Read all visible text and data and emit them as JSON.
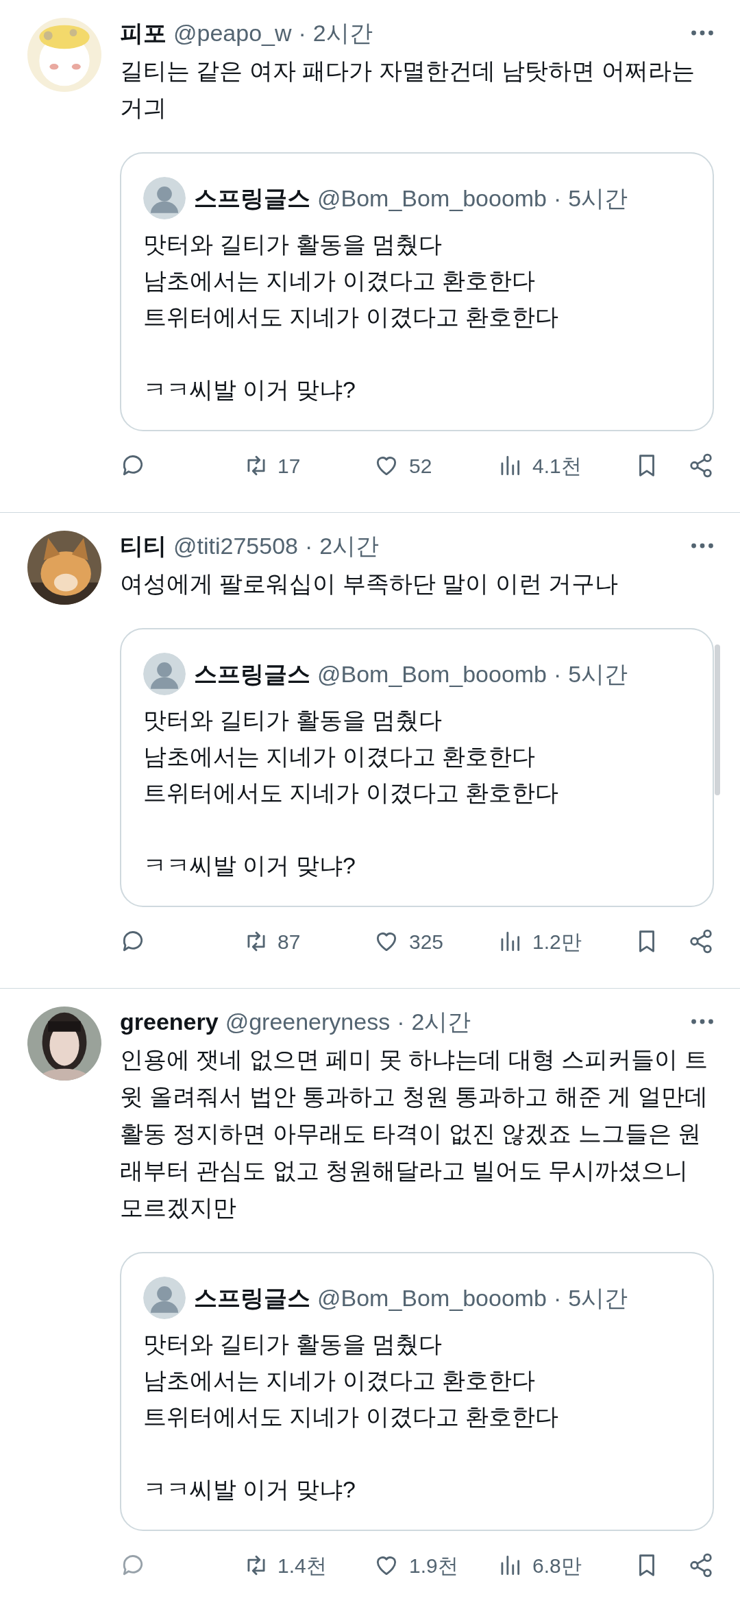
{
  "separator": "·",
  "tweets": [
    {
      "author": {
        "name": "피포",
        "handle": "@peapo_w",
        "time": "2시간"
      },
      "text": "길티는 같은 여자 패다가 자멸한건데 남탓하면 어쩌라는 거긔",
      "quote": {
        "name": "스프링글스",
        "handle": "@Bom_Bom_booomb",
        "time": "5시간",
        "text": "맛터와 길티가 활동을 멈췄다\n남초에서는 지네가 이겼다고 환호한다\n트위터에서도 지네가 이겼다고 환호한다\n\nㅋㅋ씨발 이거 맞냐?"
      },
      "stats": {
        "retweets": "17",
        "likes": "52",
        "views": "4.1천"
      }
    },
    {
      "author": {
        "name": "티티",
        "handle": "@titi275508",
        "time": "2시간"
      },
      "text": "여성에게 팔로워십이 부족하단 말이 이런 거구나",
      "quote": {
        "name": "스프링글스",
        "handle": "@Bom_Bom_booomb",
        "time": "5시간",
        "text": "맛터와 길티가 활동을 멈췄다\n남초에서는 지네가 이겼다고 환호한다\n트위터에서도 지네가 이겼다고 환호한다\n\nㅋㅋ씨발 이거 맞냐?"
      },
      "stats": {
        "retweets": "87",
        "likes": "325",
        "views": "1.2만"
      }
    },
    {
      "author": {
        "name": "greenery",
        "handle": "@greeneryness",
        "time": "2시간"
      },
      "text": "인용에 잿네 없으면 페미 못 하냐는데 대형 스피커들이 트윗 올려줘서 법안 통과하고 청원 통과하고 해준 게 얼만데 활동 정지하면 아무래도 타격이 없진 않겠죠 느그들은 원래부터 관심도 없고 청원해달라고 빌어도 무시까셨으니 모르겠지만",
      "quote": {
        "name": "스프링글스",
        "handle": "@Bom_Bom_booomb",
        "time": "5시간",
        "text": "맛터와 길티가 활동을 멈췄다\n남초에서는 지네가 이겼다고 환호한다\n트위터에서도 지네가 이겼다고 환호한다\n\nㅋㅋ씨발 이거 맞냐?"
      },
      "stats": {
        "retweets": "1.4천",
        "likes": "1.9천",
        "views": "6.8만"
      }
    }
  ]
}
